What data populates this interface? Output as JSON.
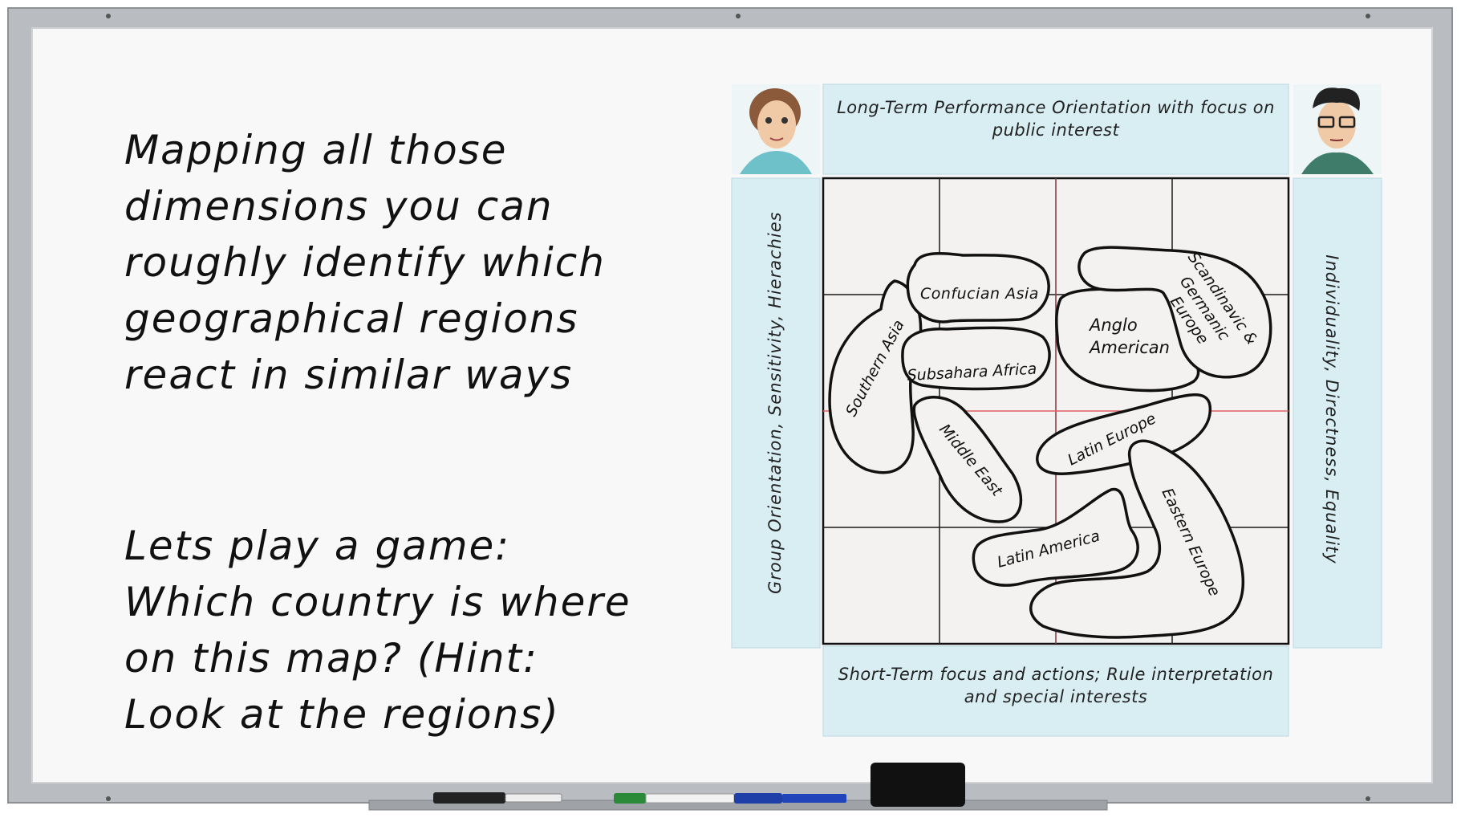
{
  "intro": {
    "lines": [
      "Mapping all those",
      "dimensions you can",
      "roughly identify which",
      "geographical regions",
      "react in similar ways"
    ]
  },
  "game": {
    "lines": [
      "Lets play a game:",
      "Which country is where",
      "on this map? (Hint:",
      "Look at the regions)"
    ]
  },
  "axes": {
    "top": "Long-Term Performance Orientation with focus on public interest",
    "bottom": "Short-Term focus and actions; Rule interpretation and special interests",
    "left": "Group Orientation, Sensitivity, Hierachies",
    "right": "Individuality, Directness, Equality"
  },
  "regions": {
    "confucian_asia": "Confucian Asia",
    "southern_asia": "Southern Asia",
    "subsahara_africa": "Subsahara Africa",
    "middle_east": "Middle East",
    "anglo_american_line1": "Anglo",
    "anglo_american_line2": "American",
    "scandinavic_line1": "Scandinavic &",
    "scandinavic_line2": "Germanic",
    "scandinavic_line3": "Europe",
    "latin_europe": "Latin Europe",
    "latin_america": "Latin America",
    "eastern_europe": "Eastern Europe"
  },
  "colors": {
    "axis_panel": "#d8eef3",
    "board_frame": "#b9bcc0",
    "board_surface": "#f8f8f8",
    "grid_line": "#1a1a1a",
    "center_cross": "#e06060",
    "eraser": "#111111"
  }
}
